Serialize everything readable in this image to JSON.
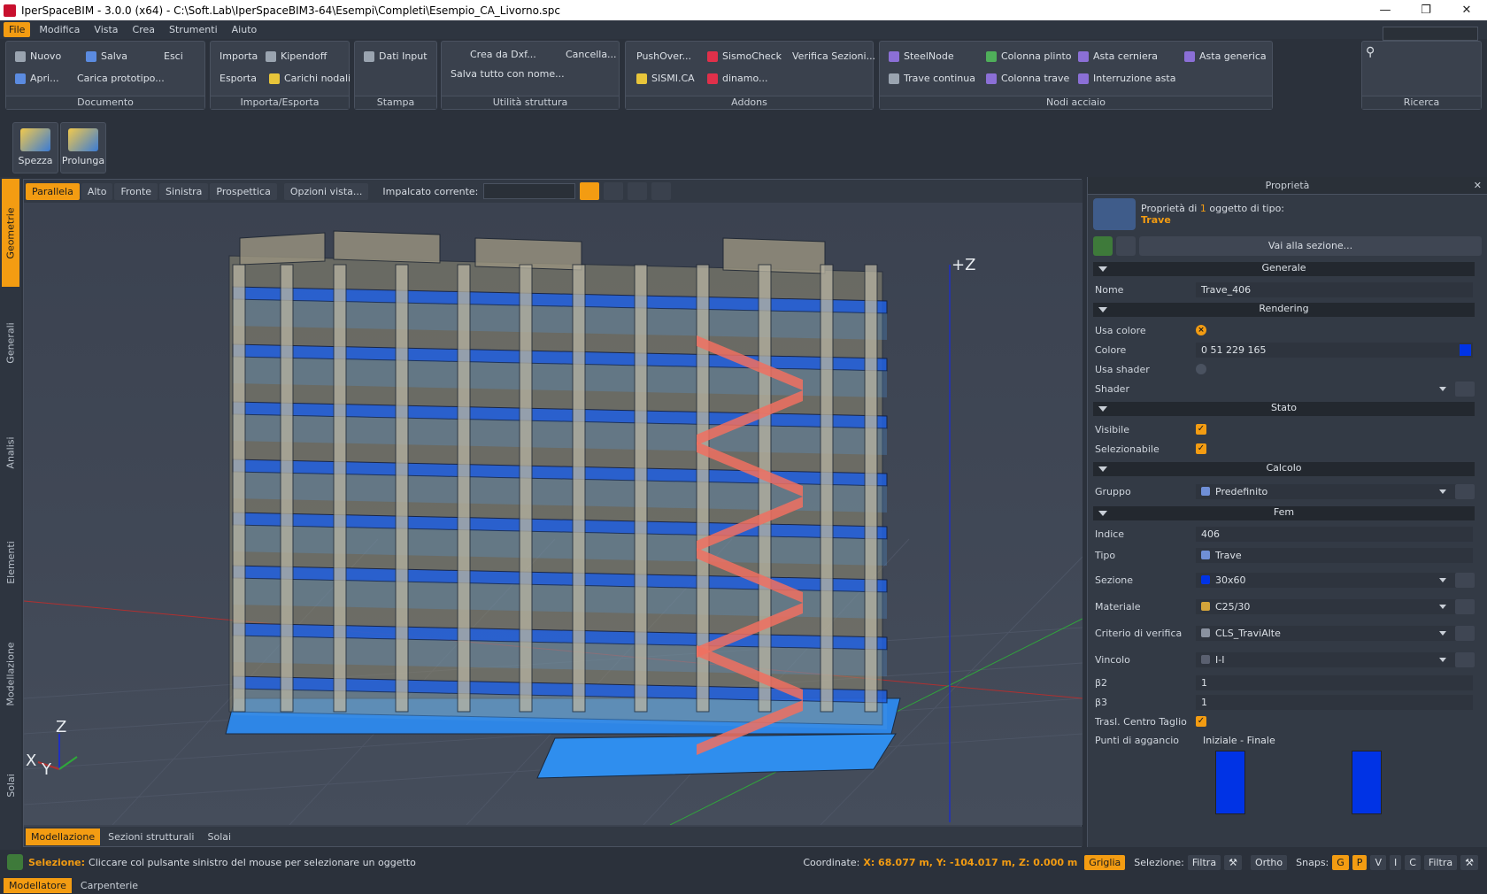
{
  "window": {
    "title": "IperSpaceBIM - 3.0.0 (x64) - C:\\Soft.Lab\\IperSpaceBIM3-64\\Esempi\\Completi\\Esempio_CA_Livorno.spc",
    "min": "—",
    "max": "❐",
    "close": "✕"
  },
  "menu": [
    "File",
    "Modifica",
    "Vista",
    "Crea",
    "Strumenti",
    "Aiuto"
  ],
  "ribbon": {
    "documento": {
      "label": "Documento",
      "nuovo": "Nuovo",
      "salva": "Salva",
      "esci": "Esci",
      "apri": "Apri...",
      "carica": "Carica prototipo..."
    },
    "importa": {
      "label": "Importa/Esporta",
      "importa": "Importa",
      "kipendoff": "Kipendoff",
      "esporta": "Esporta",
      "carichi": "Carichi nodali"
    },
    "stampa": {
      "label": "Stampa",
      "dati": "Dati Input"
    },
    "utilita": {
      "label": "Utilità struttura",
      "crea": "Crea da Dxf...",
      "cancella": "Cancella...",
      "salvatutto": "Salva tutto con nome..."
    },
    "addons": {
      "label": "Addons",
      "push": "PushOver...",
      "sismo": "SismoCheck",
      "verifica": "Verifica Sezioni...",
      "sismica": "SISMI.CA",
      "dinamo": "dinamo..."
    },
    "nodi": {
      "label": "Nodi acciaio",
      "steel": "SteelNode",
      "plinto": "Colonna plinto",
      "cerniera": "Asta cerniera",
      "generica": "Asta generica",
      "travec": "Trave continua",
      "colonnat": "Colonna trave",
      "interruz": "Interruzione asta"
    },
    "ricerca": {
      "label": "Ricerca"
    }
  },
  "tools": {
    "spezza": "Spezza",
    "prolunga": "Prolunga"
  },
  "lefttabs": [
    "Geometrie",
    "Generali",
    "Analisi",
    "Elementi",
    "Modellazione",
    "Solai"
  ],
  "view": {
    "buttons": [
      "Parallela",
      "Alto",
      "Fronte",
      "Sinistra",
      "Prospettica"
    ],
    "opzioni": "Opzioni vista...",
    "impalcato": "Impalcato corrente:",
    "zlabel": "+Z",
    "axes": {
      "z": "Z",
      "x": "X",
      "y": "Y"
    },
    "bottomtabs": [
      "Modellazione",
      "Sezioni strutturali",
      "Solai"
    ]
  },
  "props": {
    "title": "Proprietà",
    "close": "✕",
    "head_prefix": "Proprietà di ",
    "head_count": "1",
    "head_suffix": " oggetto di tipo:",
    "head_type": "Trave",
    "goto": "Vai alla sezione...",
    "sec_generale": "Generale",
    "nome_l": "Nome",
    "nome_v": "Trave_406",
    "sec_rendering": "Rendering",
    "usacolore_l": "Usa colore",
    "colore_l": "Colore",
    "colore_v": "0 51 229 165",
    "color_hex": "#0033e5",
    "usashader_l": "Usa shader",
    "shader_l": "Shader",
    "sec_stato": "Stato",
    "visibile_l": "Visibile",
    "selez_l": "Selezionabile",
    "sec_calcolo": "Calcolo",
    "gruppo_l": "Gruppo",
    "gruppo_v": "Predefinito",
    "sec_fem": "Fem",
    "indice_l": "Indice",
    "indice_v": "406",
    "tipo_l": "Tipo",
    "tipo_v": "Trave",
    "sezione_l": "Sezione",
    "sezione_v": "30x60",
    "materiale_l": "Materiale",
    "materiale_v": "C25/30",
    "criterio_l": "Criterio di verifica",
    "criterio_v": "CLS_TraviAlte",
    "vincolo_l": "Vincolo",
    "vincolo_v": "I-I",
    "b2_l": "β2",
    "b2_v": "1",
    "b3_l": "β3",
    "b3_v": "1",
    "trasl_l": "Trasl. Centro Taglio",
    "punti_l": "Punti di aggancio",
    "punti_v": "Iniziale - Finale"
  },
  "status": {
    "selezione_l": "Selezione:",
    "selezione_v": "Cliccare col pulsante sinistro del mouse per selezionare un oggetto",
    "coord_l": "Coordinate:",
    "coord_v": "X: 68.077 m, Y: -104.017 m, Z: 0.000 m",
    "griglia": "Griglia",
    "selez2": "Selezione:",
    "filtra": "Filtra",
    "ortho": "Ortho",
    "snaps": "Snaps:",
    "snapkeys": [
      "G",
      "P",
      "V",
      "I",
      "C"
    ],
    "filtra2": "Filtra"
  },
  "modes": [
    "Modellatore",
    "Carpenterie"
  ]
}
